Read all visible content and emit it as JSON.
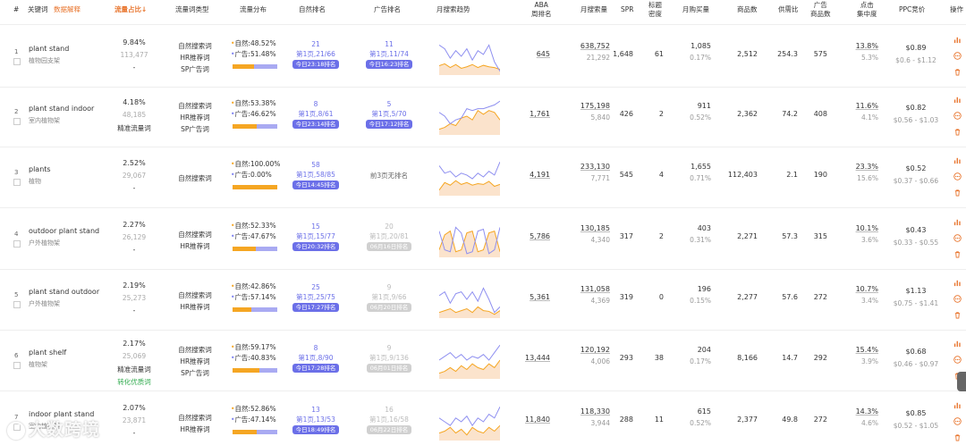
{
  "header": {
    "num": "#",
    "keyword": "关键词",
    "keyword_link": "数据解释",
    "traffic_share": "流量占比",
    "traffic_share_badge": "",
    "word_type": "流量词类型",
    "distribution": "流量分布",
    "natural_rank": "自然排名",
    "ad_rank": "广告排名",
    "trend": "月搜索趋势",
    "aba_line1": "ABA",
    "aba_line2": "周排名",
    "monthly_search": "月搜索量",
    "spr": "SPR",
    "title_density_1": "标题",
    "title_density_2": "密度",
    "monthly_buy": "月购买量",
    "product_count": "商品数",
    "supply_ratio": "供需比",
    "ad_products_1": "广告",
    "ad_products_2": "商品数",
    "click_concentration_1": "点击",
    "click_concentration_2": "集中度",
    "ppc": "PPC竞价",
    "ops": "操作"
  },
  "rows": [
    {
      "num": "1",
      "kw": "plant stand",
      "kw_cn": "植物园支架",
      "pct": "9.84%",
      "cnt": "113,477",
      "extra": "-",
      "extra_green": "",
      "types": [
        "自然搜索词",
        "HR推荐词",
        "SP广告词"
      ],
      "nat_share": "48.52%",
      "ad_share": "51.48%",
      "nat_rank": "21",
      "nat_pos": "第1页,21/66",
      "nat_tag": "今日23:18排名",
      "ad_rank": "11",
      "ad_pos": "第1页,11/74",
      "ad_tag": "今日16:23排名",
      "ad_grey": false,
      "ad_text": "",
      "aba": "645",
      "search": "638,752",
      "search_sub": "21,292",
      "spr": "1,648",
      "density": "61",
      "buy": "1,085",
      "buy_rate": "0.17%",
      "products": "2,512",
      "supply": "254.3",
      "ad_products": "575",
      "click1": "13.8%",
      "click2": "5.3%",
      "ppc": "$0.89",
      "ppc_range": "$0.6 - $1.12",
      "nat_frac": 0.485
    },
    {
      "num": "2",
      "kw": "plant stand indoor",
      "kw_cn": "室内植物架",
      "pct": "4.18%",
      "cnt": "48,185",
      "extra": "精准流量词",
      "extra_green": "",
      "types": [
        "自然搜索词",
        "HR推荐词",
        "SP广告词"
      ],
      "nat_share": "53.38%",
      "ad_share": "46.62%",
      "nat_rank": "8",
      "nat_pos": "第1页,8/61",
      "nat_tag": "今日23:14排名",
      "ad_rank": "5",
      "ad_pos": "第1页,5/70",
      "ad_tag": "今日17:12排名",
      "ad_grey": false,
      "ad_text": "",
      "aba": "1,761",
      "search": "175,198",
      "search_sub": "5,840",
      "spr": "426",
      "density": "2",
      "buy": "911",
      "buy_rate": "0.52%",
      "products": "2,362",
      "supply": "74.2",
      "ad_products": "408",
      "click1": "11.6%",
      "click2": "4.1%",
      "ppc": "$0.82",
      "ppc_range": "$0.56 - $1.03",
      "nat_frac": 0.534
    },
    {
      "num": "3",
      "kw": "plants",
      "kw_cn": "植物",
      "pct": "2.52%",
      "cnt": "29,067",
      "extra": "-",
      "extra_green": "",
      "types": [
        "自然搜索词"
      ],
      "nat_share": "100.00%",
      "ad_share": "0.00%",
      "nat_rank": "58",
      "nat_pos": "第1页,58/85",
      "nat_tag": "今日14:45排名",
      "ad_rank": "",
      "ad_pos": "",
      "ad_tag": "",
      "ad_grey": false,
      "ad_text": "前3页无排名",
      "aba": "4,191",
      "search": "233,130",
      "search_sub": "7,771",
      "spr": "545",
      "density": "4",
      "buy": "1,655",
      "buy_rate": "0.71%",
      "products": "112,403",
      "supply": "2.1",
      "ad_products": "190",
      "click1": "23.3%",
      "click2": "15.6%",
      "ppc": "$0.52",
      "ppc_range": "$0.37 - $0.66",
      "nat_frac": 1.0
    },
    {
      "num": "4",
      "kw": "outdoor plant stand",
      "kw_cn": "户外植物架",
      "pct": "2.27%",
      "cnt": "26,129",
      "extra": "-",
      "extra_green": "",
      "types": [
        "自然搜索词",
        "HR推荐词"
      ],
      "nat_share": "52.33%",
      "ad_share": "47.67%",
      "nat_rank": "15",
      "nat_pos": "第1页,15/77",
      "nat_tag": "今日20:32排名",
      "ad_rank": "20",
      "ad_pos": "第1页,20/81",
      "ad_tag": "06月16日排名",
      "ad_grey": true,
      "ad_text": "",
      "aba": "5,786",
      "search": "130,185",
      "search_sub": "4,340",
      "spr": "317",
      "density": "2",
      "buy": "403",
      "buy_rate": "0.31%",
      "products": "2,271",
      "supply": "57.3",
      "ad_products": "315",
      "click1": "10.1%",
      "click2": "3.6%",
      "ppc": "$0.43",
      "ppc_range": "$0.33 - $0.55",
      "nat_frac": 0.523
    },
    {
      "num": "5",
      "kw": "plant stand outdoor",
      "kw_cn": "户外植物架",
      "pct": "2.19%",
      "cnt": "25,273",
      "extra": "-",
      "extra_green": "",
      "types": [
        "自然搜索词",
        "HR推荐词"
      ],
      "nat_share": "42.86%",
      "ad_share": "57.14%",
      "nat_rank": "25",
      "nat_pos": "第1页,25/75",
      "nat_tag": "今日17:27排名",
      "ad_rank": "9",
      "ad_pos": "第1页,9/66",
      "ad_tag": "06月20日排名",
      "ad_grey": true,
      "ad_text": "",
      "aba": "5,361",
      "search": "131,058",
      "search_sub": "4,369",
      "spr": "319",
      "density": "0",
      "buy": "196",
      "buy_rate": "0.15%",
      "products": "2,277",
      "supply": "57.6",
      "ad_products": "272",
      "click1": "10.7%",
      "click2": "3.4%",
      "ppc": "$1.13",
      "ppc_range": "$0.75 - $1.41",
      "nat_frac": 0.429
    },
    {
      "num": "6",
      "kw": "plant shelf",
      "kw_cn": "植物架",
      "pct": "2.17%",
      "cnt": "25,069",
      "extra": "精准流量词",
      "extra_green": "转化优质词",
      "types": [
        "自然搜索词",
        "HR推荐词",
        "SP广告词"
      ],
      "nat_share": "59.17%",
      "ad_share": "40.83%",
      "nat_rank": "8",
      "nat_pos": "第1页,8/90",
      "nat_tag": "今日17:28排名",
      "ad_rank": "9",
      "ad_pos": "第1页,9/136",
      "ad_tag": "06月01日排名",
      "ad_grey": true,
      "ad_text": "",
      "aba": "13,444",
      "search": "120,192",
      "search_sub": "4,006",
      "spr": "293",
      "density": "38",
      "buy": "204",
      "buy_rate": "0.17%",
      "products": "8,166",
      "supply": "14.7",
      "ad_products": "292",
      "click1": "15.4%",
      "click2": "3.9%",
      "ppc": "$0.68",
      "ppc_range": "$0.46 - $0.97",
      "nat_frac": 0.592
    },
    {
      "num": "7",
      "kw": "indoor plant stand",
      "kw_cn": "室内植物架",
      "pct": "2.07%",
      "cnt": "23,871",
      "extra": "-",
      "extra_green": "",
      "types": [
        "自然搜索词",
        "HR推荐词"
      ],
      "nat_share": "52.86%",
      "ad_share": "47.14%",
      "nat_rank": "13",
      "nat_pos": "第1页,13/53",
      "nat_tag": "今日18:49排名",
      "ad_rank": "16",
      "ad_pos": "第1页,16/58",
      "ad_tag": "06月22日排名",
      "ad_grey": true,
      "ad_text": "",
      "aba": "11,840",
      "search": "118,330",
      "search_sub": "3,944",
      "spr": "288",
      "density": "11",
      "buy": "615",
      "buy_rate": "0.52%",
      "products": "2,377",
      "supply": "49.8",
      "ad_products": "272",
      "click1": "14.3%",
      "click2": "4.6%",
      "ppc": "$0.85",
      "ppc_range": "$0.52 - $1.05",
      "nat_frac": 0.529
    }
  ],
  "labels": {
    "natural": "自然:",
    "ad": "广告:"
  },
  "watermark": "大数跨境",
  "colors": {
    "accent": "#e8742c",
    "purple": "#6b6fe8",
    "orange": "#f5a623",
    "green": "#2eaa4c"
  }
}
